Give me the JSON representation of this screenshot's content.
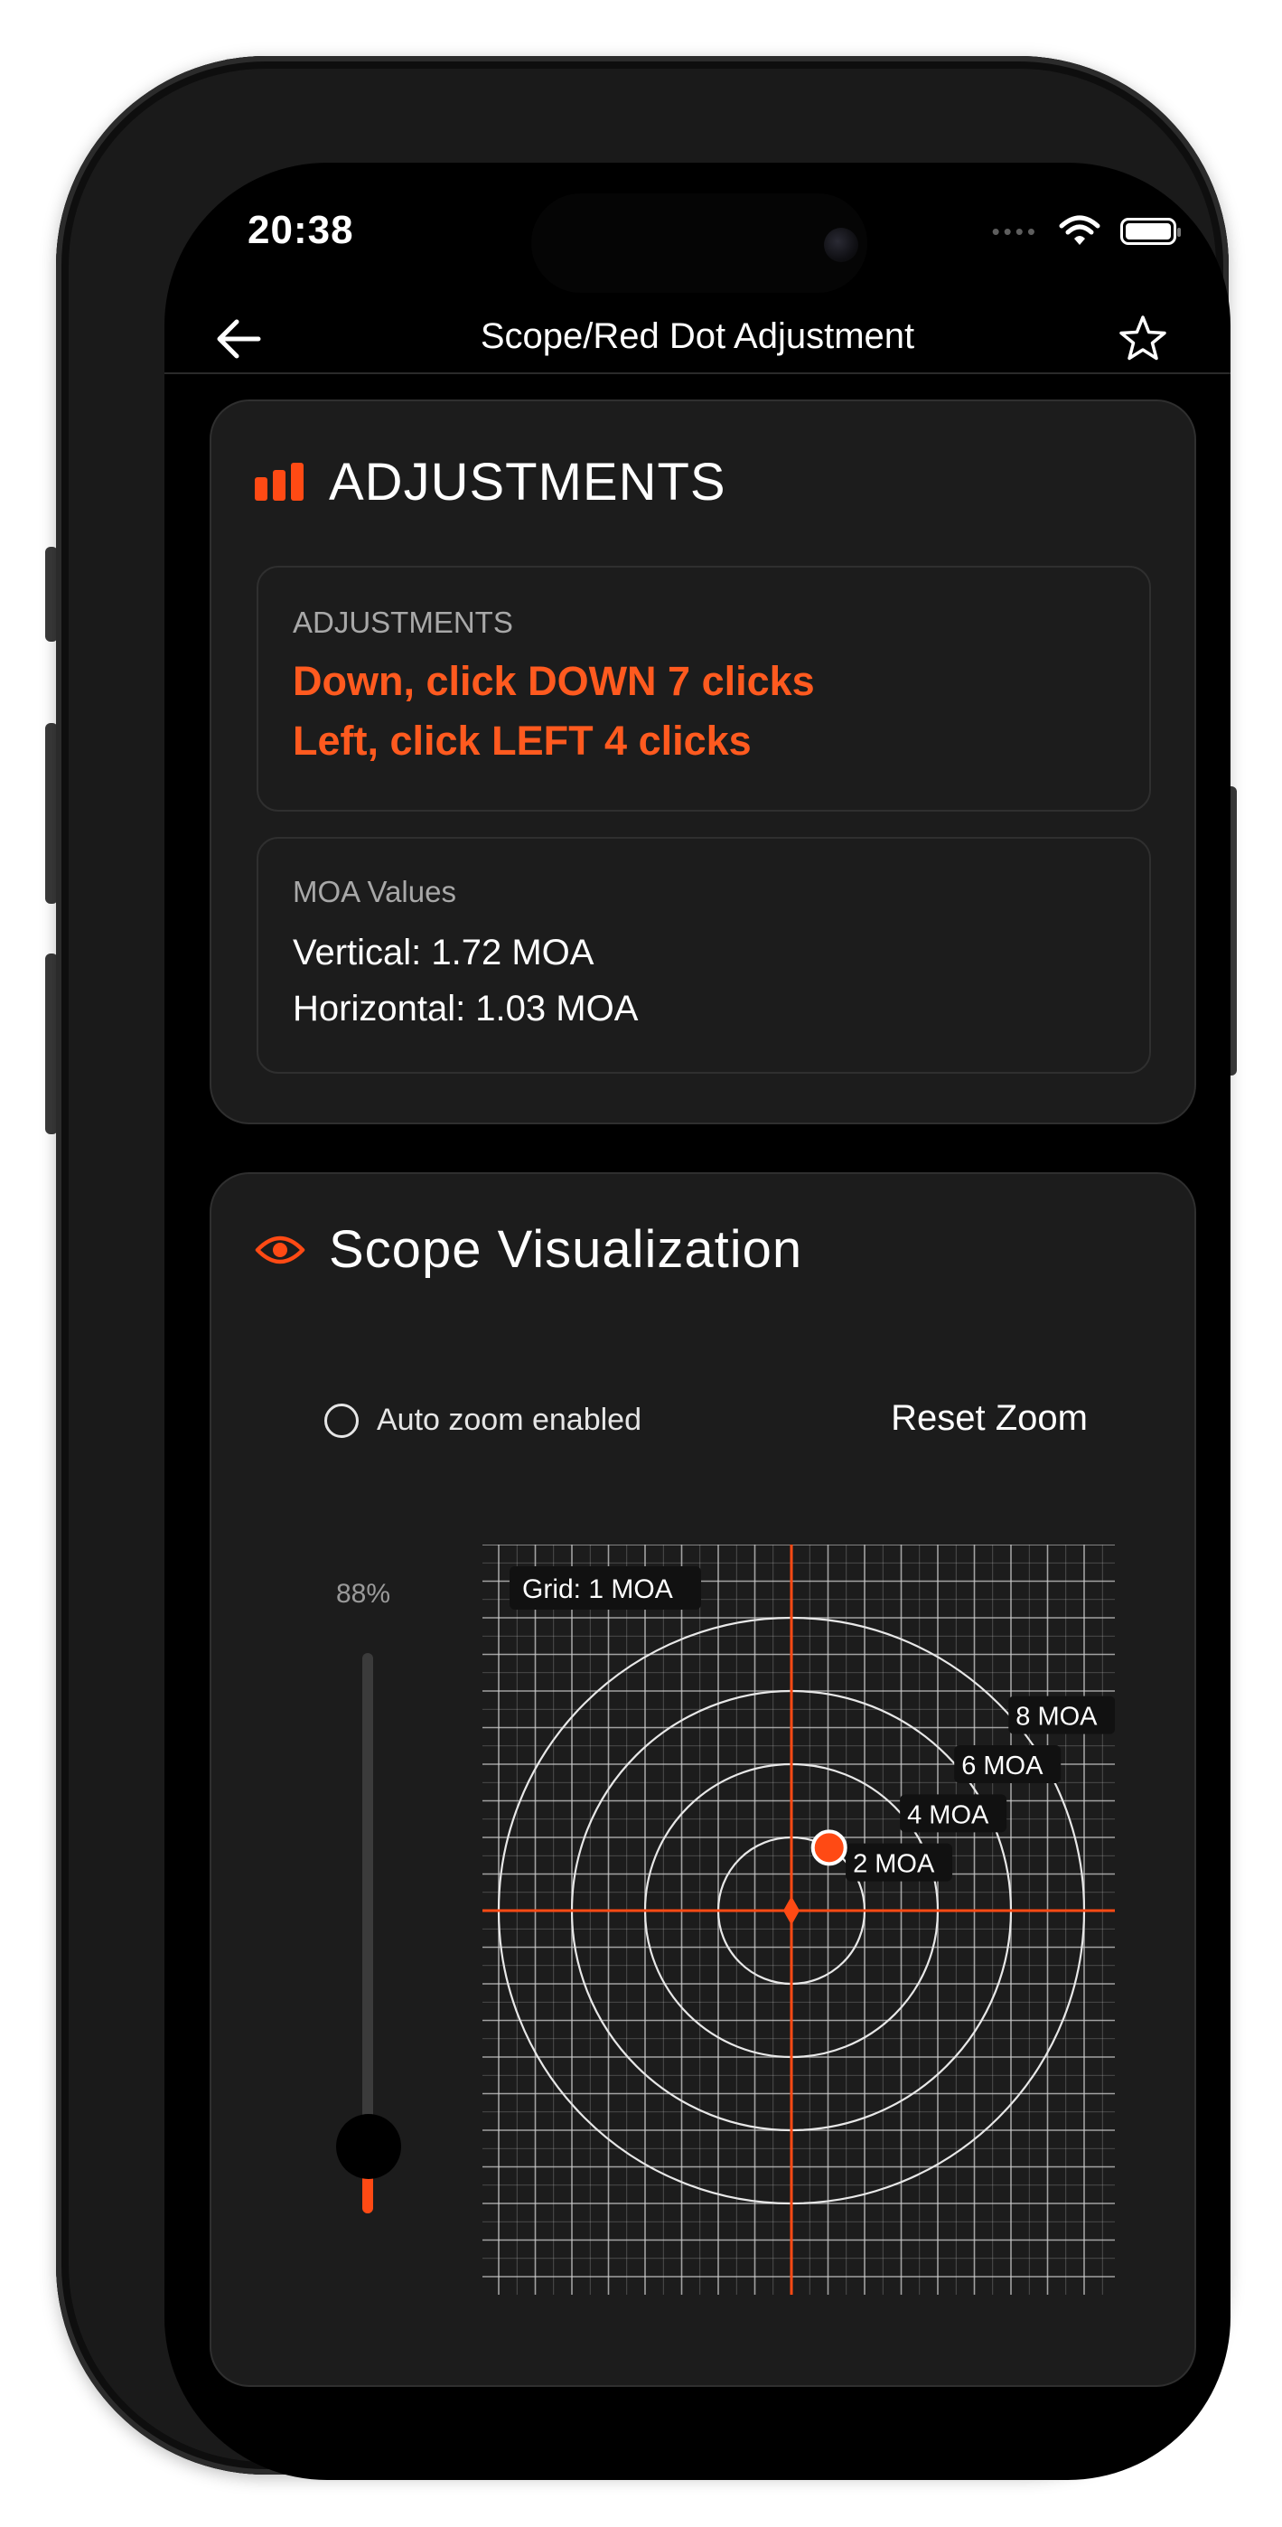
{
  "status_bar": {
    "time": "20:38"
  },
  "nav": {
    "title": "Scope/Red Dot Adjustment"
  },
  "adjustments_card": {
    "title": "ADJUSTMENTS",
    "adjust_label": "ADJUSTMENTS",
    "line1": "Down, click DOWN 7 clicks",
    "line2": "Left, click LEFT 4 clicks",
    "moa_label": "MOA Values",
    "vertical": "Vertical: 1.72 MOA",
    "horizontal": "Horizontal: 1.03 MOA"
  },
  "scope_card": {
    "title": "Scope Visualization",
    "auto_zoom_label": "Auto zoom enabled",
    "auto_zoom_enabled": false,
    "reset_zoom": "Reset Zoom",
    "zoom_percent": "88%",
    "zoom_slider_fraction": 0.12,
    "grid_label": "Grid: 1 MOA",
    "rings": [
      {
        "moa": 2,
        "label": "2 MOA"
      },
      {
        "moa": 4,
        "label": "4 MOA"
      },
      {
        "moa": 6,
        "label": "6 MOA"
      },
      {
        "moa": 8,
        "label": "8 MOA"
      }
    ],
    "impact_moa": {
      "x": 1.03,
      "y": 1.72
    }
  },
  "colors": {
    "accent": "#ff4a14",
    "accent_text": "#ff5a1f",
    "card_bg": "#1c1c1c",
    "screen_bg": "#000000",
    "grid_line": "#cfcfcf"
  },
  "icons": {
    "back": "arrow-left-icon",
    "favorite": "star-outline-icon",
    "adjustments": "bar-chart-icon",
    "visualization": "eye-icon"
  }
}
